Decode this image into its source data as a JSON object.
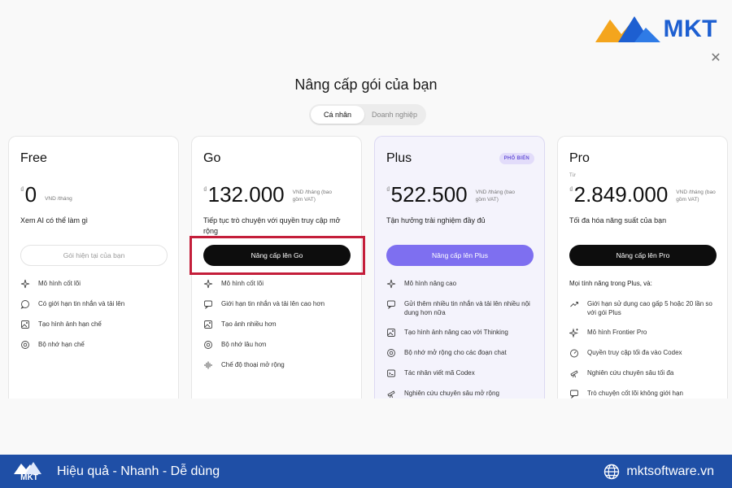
{
  "brand": {
    "logo_text": "MKT",
    "logo_colors": [
      "#1d5fd1",
      "#f4a51d"
    ]
  },
  "dialog": {
    "title": "Nâng cấp gói của bạn",
    "close_icon": "close-icon"
  },
  "toggle": {
    "personal": "Cá nhân",
    "business": "Doanh nghiệp"
  },
  "plans": [
    {
      "name": "Free",
      "currency": "₫",
      "price": "0",
      "unit": "VND /tháng",
      "tagline": "Xem AI có thể làm gì",
      "button": "Gói hiện tại của bạn",
      "features": [
        "Mô hình cốt lõi",
        "Có giới hạn tin nhắn và tải lên",
        "Tạo hình ảnh hạn chế",
        "Bộ nhớ hạn chế"
      ]
    },
    {
      "name": "Go",
      "currency": "₫",
      "price": "132.000",
      "unit": "VND /tháng (bao gồm VAT)",
      "tagline": "Tiếp tục trò chuyện với quyền truy cập mở rộng",
      "button": "Nâng cấp lên Go",
      "features": [
        "Mô hình cốt lõi",
        "Giới hạn tin nhắn và tải lên cao hơn",
        "Tạo ảnh nhiều hơn",
        "Bộ nhớ lâu hơn",
        "Chế độ thoại mở rộng"
      ]
    },
    {
      "name": "Plus",
      "badge": "PHỔ BIẾN",
      "currency": "₫",
      "price": "522.500",
      "unit": "VND /tháng (bao gồm VAT)",
      "tagline": "Tận hưởng trải nghiệm đầy đủ",
      "button": "Nâng cấp lên Plus",
      "features": [
        "Mô hình nâng cao",
        "Gửi thêm nhiều tin nhắn và tải lên nhiều nội dung hơn nữa",
        "Tạo hình ảnh nâng cao với Thinking",
        "Bộ nhớ mở rộng cho các đoạn chat",
        "Tác nhân viết mã Codex",
        "Nghiên cứu chuyên sâu mở rộng"
      ]
    },
    {
      "name": "Pro",
      "prefix": "Từ",
      "currency": "₫",
      "price": "2.849.000",
      "unit": "VND /tháng (bao gồm VAT)",
      "tagline": "Tối đa hóa năng suất của bạn",
      "button": "Nâng cấp lên Pro",
      "subheading": "Mọi tính năng trong Plus, và:",
      "features": [
        "Giới hạn sử dụng cao gấp 5 hoặc 20 lần so với gói Plus",
        "Mô hình Frontier Pro",
        "Quyền truy cập tối đa vào Codex",
        "Nghiên cứu chuyên sâu tối đa",
        "Trò chuyện cốt lõi không giới hạn"
      ]
    }
  ],
  "footer": {
    "logo_text": "MKT",
    "slogan": "Hiệu quả - Nhanh - Dễ dùng",
    "website": "mktsoftware.vn"
  }
}
